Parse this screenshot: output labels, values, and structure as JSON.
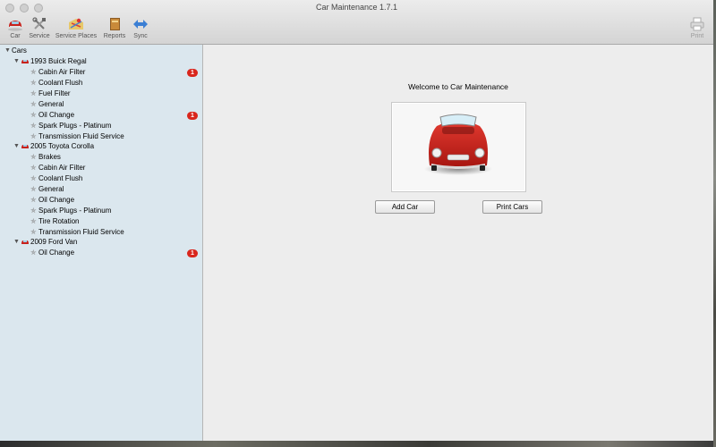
{
  "window": {
    "title": "Car Maintenance 1.7.1"
  },
  "toolbar": {
    "car": "Car",
    "service": "Service",
    "service_places": "Service Places",
    "reports": "Reports",
    "sync": "Sync",
    "print": "Print"
  },
  "sidebar": {
    "root": "Cars",
    "cars": [
      {
        "name": "1993 Buick Regal",
        "items": [
          {
            "label": "Cabin Air Filter",
            "badge": "1"
          },
          {
            "label": "Coolant Flush"
          },
          {
            "label": "Fuel Filter"
          },
          {
            "label": "General"
          },
          {
            "label": "Oil Change",
            "badge": "1"
          },
          {
            "label": "Spark Plugs - Platinum"
          },
          {
            "label": "Transmission Fluid Service"
          }
        ]
      },
      {
        "name": "2005 Toyota Corolla",
        "items": [
          {
            "label": "Brakes"
          },
          {
            "label": "Cabin Air Filter"
          },
          {
            "label": "Coolant Flush"
          },
          {
            "label": "General"
          },
          {
            "label": "Oil Change"
          },
          {
            "label": "Spark Plugs - Platinum"
          },
          {
            "label": "Tire Rotation"
          },
          {
            "label": "Transmission Fluid Service"
          }
        ]
      },
      {
        "name": "2009 Ford Van",
        "items": [
          {
            "label": "Oil Change",
            "badge": "1"
          }
        ]
      }
    ]
  },
  "main": {
    "welcome": "Welcome to Car Maintenance",
    "add_car": "Add Car",
    "print_cars": "Print Cars"
  },
  "colors": {
    "accent_red": "#d9261c",
    "sidebar_bg": "#dbe7ee"
  }
}
